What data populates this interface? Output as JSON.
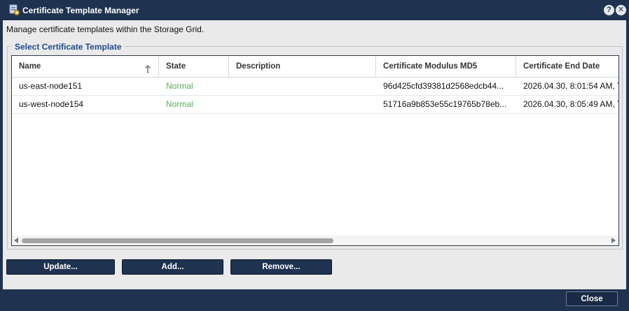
{
  "window": {
    "title": "Certificate Template Manager",
    "help_label": "?",
    "close_label": "✕"
  },
  "intro_text": "Manage certificate templates within the Storage Grid.",
  "group": {
    "legend": "Select Certificate Template"
  },
  "table": {
    "columns": {
      "name": "Name",
      "state": "State",
      "description": "Description",
      "md5": "Certificate Modulus MD5",
      "end_date": "Certificate End Date"
    },
    "sort": {
      "column": "Name",
      "direction": "ascending"
    },
    "rows": [
      {
        "name": "us-east-node151",
        "state": "Normal",
        "description": "",
        "md5": "96d425cfd39381d2568edcb44...",
        "end_date": "2026.04.30, 8:01:54 AM, T"
      },
      {
        "name": "us-west-node154",
        "state": "Normal",
        "description": "",
        "md5": "51716a9b853e55c19765b78eb...",
        "end_date": "2026.04.30, 8:05:49 AM, T"
      }
    ]
  },
  "buttons": {
    "update": "Update...",
    "add": "Add...",
    "remove": "Remove...",
    "close": "Close"
  },
  "colors": {
    "chrome": "#1f3250",
    "panel": "#eaeaea",
    "state_normal": "#5aae5a",
    "legend": "#1f4a8c"
  }
}
